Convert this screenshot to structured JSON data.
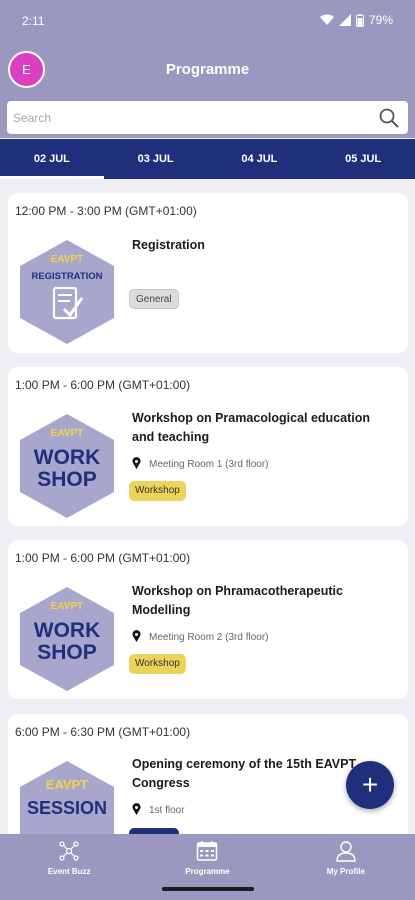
{
  "status_bar": {
    "time": "2:11",
    "battery": "79%"
  },
  "header": {
    "avatar_initial": "E",
    "title": "Programme"
  },
  "search": {
    "placeholder": "Search",
    "value": ""
  },
  "tabs": [
    {
      "label": "02 JUL",
      "active": true
    },
    {
      "label": "03 JUL",
      "active": false
    },
    {
      "label": "04 JUL",
      "active": false
    },
    {
      "label": "05 JUL",
      "active": false
    }
  ],
  "sessions": [
    {
      "time": "12:00 PM - 3:00 PM  (GMT+01:00)",
      "title": "Registration",
      "location": "",
      "tag": "General",
      "image": {
        "brand": "EAVPT",
        "label": "REGISTRATION",
        "icon": "document-check-icon"
      }
    },
    {
      "time": "1:00 PM - 6:00 PM  (GMT+01:00)",
      "title": "Workshop on Pramacological education and teaching",
      "location": "Meeting Room 1 (3rd floor)",
      "tag": "Workshop",
      "image": {
        "brand": "EAVPT",
        "line1": "WORK",
        "line2": "SHOP"
      }
    },
    {
      "time": "1:00 PM - 6:00 PM  (GMT+01:00)",
      "title": "Workshop on Phramacotherapeutic Modelling",
      "location": "Meeting Room 2 (3rd floor)",
      "tag": "Workshop",
      "image": {
        "brand": "EAVPT",
        "line1": "WORK",
        "line2": "SHOP"
      }
    },
    {
      "time": "6:00 PM - 6:30 PM  (GMT+01:00)",
      "title": "Opening ceremony of the 15th EAVPT Congress",
      "location": "1st floor",
      "tag": "",
      "image": {
        "brand": "EAVPT",
        "label": "SESSION"
      }
    }
  ],
  "fab": {
    "symbol": "+",
    "icon": "plus-icon"
  },
  "bottom_nav": [
    {
      "label": "Event Buzz",
      "icon": "network-icon",
      "active": false
    },
    {
      "label": "Programme",
      "icon": "calendar-icon",
      "active": true
    },
    {
      "label": "My Profile",
      "icon": "person-icon",
      "active": false
    }
  ],
  "colors": {
    "header": "#9a98bf",
    "tabs": "#1f2f7c",
    "avatar": "#d93fc0",
    "hexagon": "#a8a6cc",
    "brand_text": "#f0d34a",
    "workshop_tag": "#ecd35a",
    "general_tag": "#dcdcdc"
  }
}
